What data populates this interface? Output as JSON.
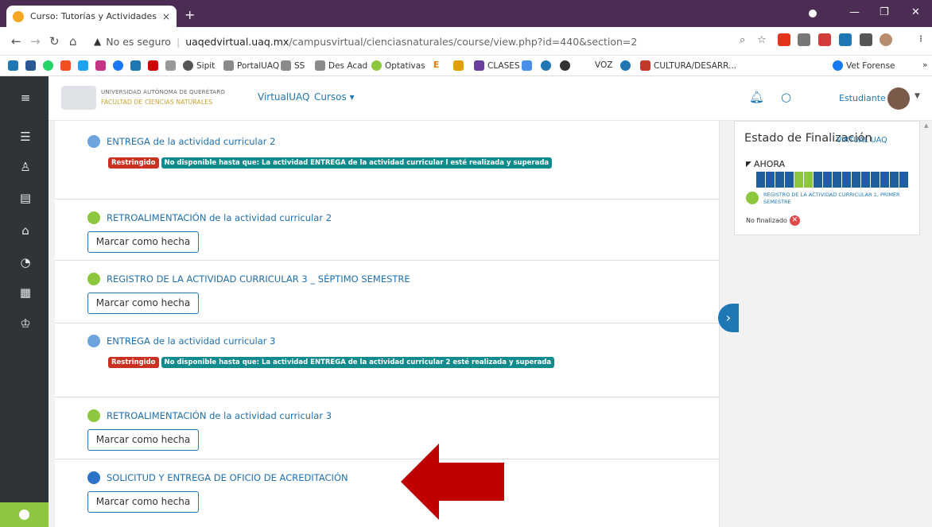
{
  "browser": {
    "tab_title": "Curso: Tutorías y Actividades Cur",
    "tab_close": "×",
    "new_tab": "+",
    "security_label": "No es seguro",
    "url_host": "uaqedvirtual.uaq.mx",
    "url_path": "/campusvirtual/cienciasnaturales/course/view.php?id=440&section=2",
    "bookmarks": [
      "Sipit",
      "PortalUAQ",
      "SS",
      "Des Acad",
      "Optativas",
      "CLASES",
      "VOZ",
      "CULTURA/DESARR...",
      "Vet Forense"
    ]
  },
  "header": {
    "university": "UNIVERSIDAD AUTÓNOMA DE QUERÉTARO",
    "faculty": "FACULTAD DE CIENCIAS NATURALES",
    "brand": "VirtualUAQ",
    "courses_menu": "Cursos ▾",
    "user_role": "Estudiante"
  },
  "activities": [
    {
      "title": "ENTREGA de la actividad curricular 2",
      "restricted": "Restringido",
      "restriction_text": "No disponible hasta que: La actividad ENTREGA de la actividad curricular l esté realizada y superada"
    },
    {
      "title": "RETROALIMENTACIÓN de la actividad curricular 2",
      "button": "Marcar como hecha"
    },
    {
      "title": "REGISTRO DE LA ACTIVIDAD CURRICULAR 3 _ SÉPTIMO SEMESTRE",
      "button": "Marcar como hecha"
    },
    {
      "title": "ENTREGA de la actividad curricular 3",
      "restricted": "Restringido",
      "restriction_text": "No disponible hasta que: La actividad ENTREGA de la actividad curricular 2 esté realizada y superada"
    },
    {
      "title": "RETROALIMENTACIÓN de la actividad curricular 3",
      "button": "Marcar como hecha"
    },
    {
      "title": "SOLICITUD Y ENTREGA DE OFICIO DE ACREDITACIÓN",
      "button": "Marcar como hecha"
    }
  ],
  "completion_block": {
    "title": "Estado de Finalización",
    "overlay": "VIRTUAL UAQ",
    "now_label": "AHORA",
    "activity_link": "REGISTRO DE LA ACTIVIDAD CURRICULAR 1, PRIMER SEMESTRE",
    "status": "No finalizado"
  },
  "colors": {
    "accent": "#1f78b4",
    "restricted": "#ca3120",
    "info": "#0f8b8d",
    "nav": "#2f3439",
    "complete": "#8dc63f",
    "arrow": "#c00000"
  }
}
